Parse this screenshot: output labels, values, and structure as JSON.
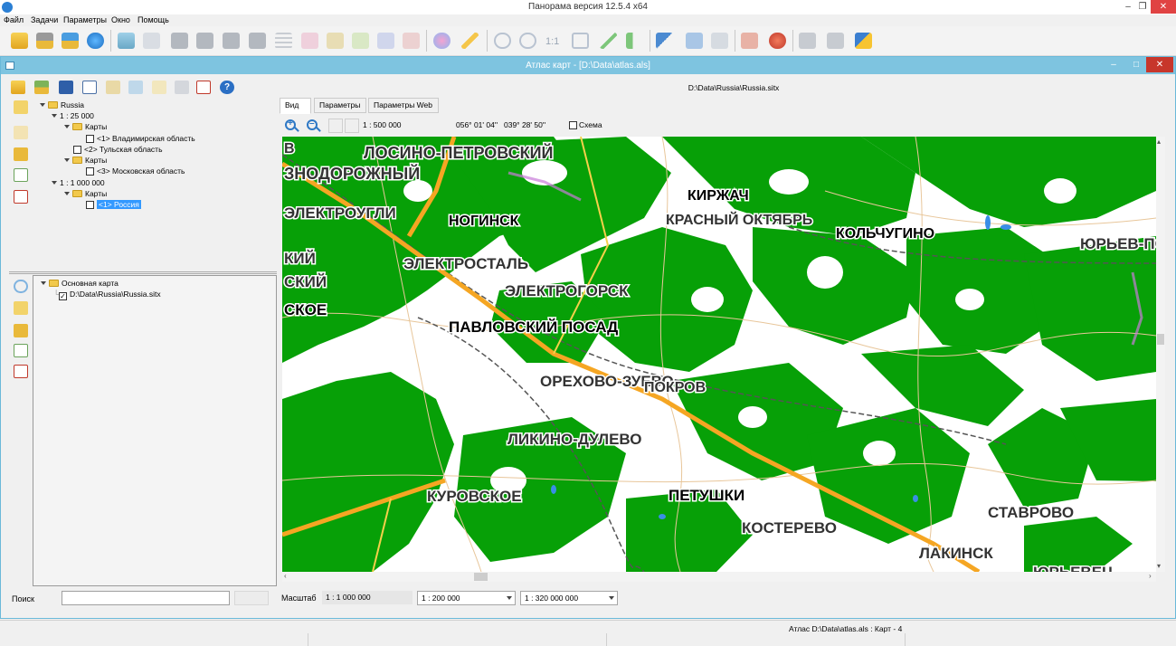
{
  "app": {
    "title": "Панорама версия 12.5.4 x64"
  },
  "window_buttons": {
    "minimize": "–",
    "restore": "❐",
    "close": "✕"
  },
  "menu": [
    "Файл",
    "Задачи",
    "Параметры",
    "Окно",
    "Помощь"
  ],
  "toolbar_icons": [
    "open-folder-icon",
    "open-vector-icon",
    "open-atlas-icon",
    "open-globe-icon",
    "layers-icon",
    "scan-icon",
    "binoculars-icon",
    "binoculars-icon",
    "binoculars-icon",
    "binoculars-icon",
    "list-icon",
    "pencil-icon",
    "pencil-icon",
    "pencil-icon",
    "pencil-icon",
    "pencil-icon",
    "palette-icon",
    "lightning-icon",
    "zoom-out-icon",
    "zoom-in-icon",
    "scale-1-1-icon",
    "fit-icon",
    "check-icon",
    "back-icon",
    "pointer-icon",
    "select-icon",
    "text-icon",
    "scissors-icon",
    "pin-icon",
    "print-icon",
    "print-icon",
    "help-pointer-icon"
  ],
  "toolbar_scale_label": "1:1",
  "atlas_window": {
    "title": "Атлас карт - [D:\\Data\\atlas.als]",
    "min": "–",
    "max": "□",
    "close": "✕"
  },
  "atlas_toolbar_icons": [
    "open-folder-icon",
    "open-vector-icon",
    "save-icon",
    "copy-icon",
    "map-icon",
    "image-icon",
    "frame-icon",
    "print-icon",
    "print-preview-icon",
    "help-icon"
  ],
  "atlas_tree": {
    "root": "Russia",
    "groups": [
      {
        "scale": "1 : 25 000",
        "folders": [
          {
            "label": "Карты",
            "items": [
              {
                "label": "<1> Владимирская область",
                "checked": false
              }
            ]
          },
          {
            "label": "",
            "items": [
              {
                "label": "<2> Тульская область",
                "checked": false
              }
            ]
          },
          {
            "label": "Карты",
            "items": [
              {
                "label": "<3> Московская область",
                "checked": false
              }
            ]
          }
        ]
      },
      {
        "scale": "1 : 1 000 000",
        "folders": [
          {
            "label": "Карты",
            "items": [
              {
                "label": "<1> Россия",
                "checked": false,
                "selected": true
              }
            ]
          }
        ]
      }
    ]
  },
  "lower_tree": {
    "root": "Основная карта",
    "item": {
      "label": "D:\\Data\\Russia\\Russia.sitx",
      "checked": true
    }
  },
  "search": {
    "label": "Поиск",
    "value": ""
  },
  "map_view": {
    "path": "D:\\Data\\Russia\\Russia.sitx",
    "tabs": [
      "Вид",
      "Параметры",
      "Параметры Web"
    ],
    "scale": "1 : 500 000",
    "longitude": "056° 01' 04''",
    "latitude": "039° 28' 50''",
    "scheme_label": "Схема",
    "scheme_checked": false
  },
  "map_labels": [
    "ЛОСИНО-ПЕТРОВСКИЙ",
    "ЗНОДОРОЖНЫЙ",
    "В",
    "ЭЛЕКТРОУГЛИ",
    "НОГИНСК",
    "КИРЖАЧ",
    "КРАСНЫЙ ОКТЯБРЬ",
    "КОЛЬЧУГИНО",
    "ЮРЬЕВ-ПО",
    "КИЙ",
    "СКИЙ",
    "ЭЛЕКТРОСТАЛЬ",
    "ЭЛЕКТРОГОРСК",
    "СКОЕ",
    "ПАВЛОВСКИЙ ПОСАД",
    "ОРЕХОВО-ЗУЕВО",
    "ПОКРОВ",
    "ЛИКИНО-ДУЛЕВО",
    "КУРОВСКОЕ",
    "ПЕТУШКИ",
    "КОСТЕРЕВО",
    "СТАВРОВО",
    "ЛАКИНСК",
    "ЮРЬЕВЕЦ"
  ],
  "bottom": {
    "scale_label": "Масштаб",
    "scale_value": "1 : 1 000 000",
    "combo1": "1 : 200 000",
    "combo2": "1 : 320 000 000"
  },
  "status": {
    "text": "Атлас D:\\Data\\atlas.als : Карт - 4"
  },
  "colors": {
    "forest": "#07a007",
    "road_orange": "#f5a623",
    "water": "#3a8ee6",
    "titlebar_blue": "#7ec4e0",
    "close_red": "#c7362b",
    "selection": "#3399ff"
  }
}
